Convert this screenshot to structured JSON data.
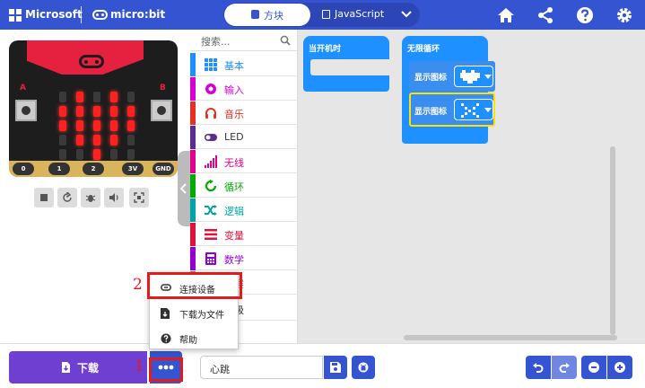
{
  "header": {
    "brand": "Microsoft",
    "product": "micro:bit",
    "tabs": [
      {
        "label": "方块",
        "active": true
      },
      {
        "label": "JavaScript",
        "active": false
      }
    ],
    "icons": [
      "home-icon",
      "share-icon",
      "help-icon",
      "settings-icon"
    ],
    "accent_color": "#3454d1"
  },
  "simulator": {
    "button_labels": {
      "a": "A",
      "b": "B"
    },
    "pins": [
      "0",
      "1",
      "2",
      "3V",
      "GND"
    ],
    "controls": [
      "stop-icon",
      "restart-icon",
      "debug-icon",
      "sound-icon",
      "fullscreen-icon"
    ]
  },
  "toolbox": {
    "search_placeholder": "搜索...",
    "categories": [
      {
        "label": "基本",
        "color": "#1e90ff"
      },
      {
        "label": "输入",
        "color": "#d400d4"
      },
      {
        "label": "音乐",
        "color": "#e63022"
      },
      {
        "label": "LED",
        "color": "#5c2d91"
      },
      {
        "label": "无线",
        "color": "#e3008c"
      },
      {
        "label": "循环",
        "color": "#00aa00"
      },
      {
        "label": "逻辑",
        "color": "#00a4a6"
      },
      {
        "label": "变量",
        "color": "#dc143c"
      },
      {
        "label": "数学",
        "color": "#9400d3"
      },
      {
        "label": "扩展",
        "color": "#888888"
      },
      {
        "label": "高级",
        "color": "#333333"
      }
    ]
  },
  "workspace": {
    "on_start_label": "当开机时",
    "forever_label": "无限循环",
    "show_icon_label_1": "显示图标",
    "show_icon_label_2": "显示图标"
  },
  "menu": {
    "items": [
      {
        "label": "连接设备",
        "icon": "link-icon"
      },
      {
        "label": "下载为文件",
        "icon": "file-download-icon"
      },
      {
        "label": "帮助",
        "icon": "help-circle-icon"
      }
    ]
  },
  "annotations": {
    "step1": "1",
    "step2": "2"
  },
  "bottombar": {
    "download_label": "下载",
    "project_name": "心跳"
  }
}
